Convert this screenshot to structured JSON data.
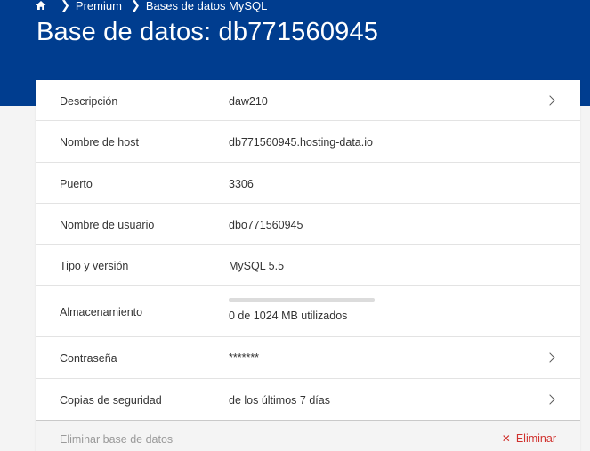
{
  "breadcrumb": {
    "home_icon": "home-icon",
    "items": [
      "Premium",
      "Bases de datos MySQL"
    ]
  },
  "header": {
    "title": "Base de datos: db771560945",
    "background": "#003d8f"
  },
  "details": {
    "rows": [
      {
        "label": "Descripción",
        "value": "daw210"
      },
      {
        "label": "Nombre de host",
        "value": "db771560945.hosting-data.io"
      },
      {
        "label": "Puerto",
        "value": "3306"
      },
      {
        "label": "Nombre de usuario",
        "value": "dbo771560945"
      },
      {
        "label": "Tipo y versión",
        "value": "MySQL 5.5"
      },
      {
        "label": "Almacenamiento",
        "value": "0 de 1024 MB utilizados",
        "usage_fraction": 0
      },
      {
        "label": "Contraseña",
        "value": "*******"
      },
      {
        "label": "Copias de seguridad",
        "value": "de los últimos 7 días"
      }
    ]
  },
  "footer": {
    "label": "Eliminar base de datos",
    "delete_label": "Eliminar",
    "delete_color": "#d0312d"
  }
}
